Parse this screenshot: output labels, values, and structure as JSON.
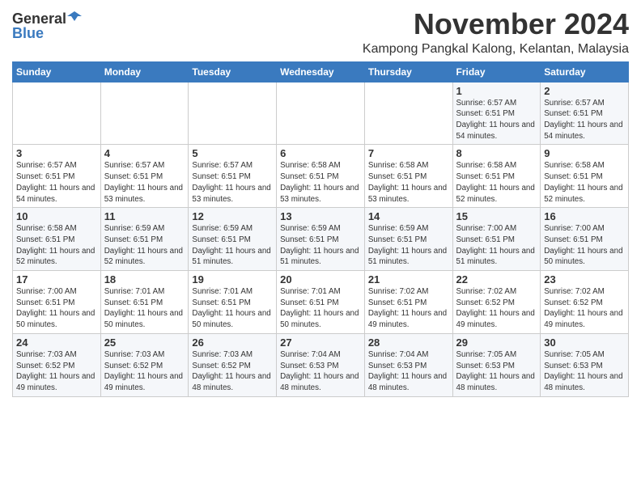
{
  "logo": {
    "general": "General",
    "blue": "Blue"
  },
  "header": {
    "month": "November 2024",
    "location": "Kampong Pangkal Kalong, Kelantan, Malaysia"
  },
  "weekdays": [
    "Sunday",
    "Monday",
    "Tuesday",
    "Wednesday",
    "Thursday",
    "Friday",
    "Saturday"
  ],
  "weeks": [
    [
      {
        "day": "",
        "sunrise": "",
        "sunset": "",
        "daylight": ""
      },
      {
        "day": "",
        "sunrise": "",
        "sunset": "",
        "daylight": ""
      },
      {
        "day": "",
        "sunrise": "",
        "sunset": "",
        "daylight": ""
      },
      {
        "day": "",
        "sunrise": "",
        "sunset": "",
        "daylight": ""
      },
      {
        "day": "",
        "sunrise": "",
        "sunset": "",
        "daylight": ""
      },
      {
        "day": "1",
        "sunrise": "Sunrise: 6:57 AM",
        "sunset": "Sunset: 6:51 PM",
        "daylight": "Daylight: 11 hours and 54 minutes."
      },
      {
        "day": "2",
        "sunrise": "Sunrise: 6:57 AM",
        "sunset": "Sunset: 6:51 PM",
        "daylight": "Daylight: 11 hours and 54 minutes."
      }
    ],
    [
      {
        "day": "3",
        "sunrise": "Sunrise: 6:57 AM",
        "sunset": "Sunset: 6:51 PM",
        "daylight": "Daylight: 11 hours and 54 minutes."
      },
      {
        "day": "4",
        "sunrise": "Sunrise: 6:57 AM",
        "sunset": "Sunset: 6:51 PM",
        "daylight": "Daylight: 11 hours and 53 minutes."
      },
      {
        "day": "5",
        "sunrise": "Sunrise: 6:57 AM",
        "sunset": "Sunset: 6:51 PM",
        "daylight": "Daylight: 11 hours and 53 minutes."
      },
      {
        "day": "6",
        "sunrise": "Sunrise: 6:58 AM",
        "sunset": "Sunset: 6:51 PM",
        "daylight": "Daylight: 11 hours and 53 minutes."
      },
      {
        "day": "7",
        "sunrise": "Sunrise: 6:58 AM",
        "sunset": "Sunset: 6:51 PM",
        "daylight": "Daylight: 11 hours and 53 minutes."
      },
      {
        "day": "8",
        "sunrise": "Sunrise: 6:58 AM",
        "sunset": "Sunset: 6:51 PM",
        "daylight": "Daylight: 11 hours and 52 minutes."
      },
      {
        "day": "9",
        "sunrise": "Sunrise: 6:58 AM",
        "sunset": "Sunset: 6:51 PM",
        "daylight": "Daylight: 11 hours and 52 minutes."
      }
    ],
    [
      {
        "day": "10",
        "sunrise": "Sunrise: 6:58 AM",
        "sunset": "Sunset: 6:51 PM",
        "daylight": "Daylight: 11 hours and 52 minutes."
      },
      {
        "day": "11",
        "sunrise": "Sunrise: 6:59 AM",
        "sunset": "Sunset: 6:51 PM",
        "daylight": "Daylight: 11 hours and 52 minutes."
      },
      {
        "day": "12",
        "sunrise": "Sunrise: 6:59 AM",
        "sunset": "Sunset: 6:51 PM",
        "daylight": "Daylight: 11 hours and 51 minutes."
      },
      {
        "day": "13",
        "sunrise": "Sunrise: 6:59 AM",
        "sunset": "Sunset: 6:51 PM",
        "daylight": "Daylight: 11 hours and 51 minutes."
      },
      {
        "day": "14",
        "sunrise": "Sunrise: 6:59 AM",
        "sunset": "Sunset: 6:51 PM",
        "daylight": "Daylight: 11 hours and 51 minutes."
      },
      {
        "day": "15",
        "sunrise": "Sunrise: 7:00 AM",
        "sunset": "Sunset: 6:51 PM",
        "daylight": "Daylight: 11 hours and 51 minutes."
      },
      {
        "day": "16",
        "sunrise": "Sunrise: 7:00 AM",
        "sunset": "Sunset: 6:51 PM",
        "daylight": "Daylight: 11 hours and 50 minutes."
      }
    ],
    [
      {
        "day": "17",
        "sunrise": "Sunrise: 7:00 AM",
        "sunset": "Sunset: 6:51 PM",
        "daylight": "Daylight: 11 hours and 50 minutes."
      },
      {
        "day": "18",
        "sunrise": "Sunrise: 7:01 AM",
        "sunset": "Sunset: 6:51 PM",
        "daylight": "Daylight: 11 hours and 50 minutes."
      },
      {
        "day": "19",
        "sunrise": "Sunrise: 7:01 AM",
        "sunset": "Sunset: 6:51 PM",
        "daylight": "Daylight: 11 hours and 50 minutes."
      },
      {
        "day": "20",
        "sunrise": "Sunrise: 7:01 AM",
        "sunset": "Sunset: 6:51 PM",
        "daylight": "Daylight: 11 hours and 50 minutes."
      },
      {
        "day": "21",
        "sunrise": "Sunrise: 7:02 AM",
        "sunset": "Sunset: 6:51 PM",
        "daylight": "Daylight: 11 hours and 49 minutes."
      },
      {
        "day": "22",
        "sunrise": "Sunrise: 7:02 AM",
        "sunset": "Sunset: 6:52 PM",
        "daylight": "Daylight: 11 hours and 49 minutes."
      },
      {
        "day": "23",
        "sunrise": "Sunrise: 7:02 AM",
        "sunset": "Sunset: 6:52 PM",
        "daylight": "Daylight: 11 hours and 49 minutes."
      }
    ],
    [
      {
        "day": "24",
        "sunrise": "Sunrise: 7:03 AM",
        "sunset": "Sunset: 6:52 PM",
        "daylight": "Daylight: 11 hours and 49 minutes."
      },
      {
        "day": "25",
        "sunrise": "Sunrise: 7:03 AM",
        "sunset": "Sunset: 6:52 PM",
        "daylight": "Daylight: 11 hours and 49 minutes."
      },
      {
        "day": "26",
        "sunrise": "Sunrise: 7:03 AM",
        "sunset": "Sunset: 6:52 PM",
        "daylight": "Daylight: 11 hours and 48 minutes."
      },
      {
        "day": "27",
        "sunrise": "Sunrise: 7:04 AM",
        "sunset": "Sunset: 6:53 PM",
        "daylight": "Daylight: 11 hours and 48 minutes."
      },
      {
        "day": "28",
        "sunrise": "Sunrise: 7:04 AM",
        "sunset": "Sunset: 6:53 PM",
        "daylight": "Daylight: 11 hours and 48 minutes."
      },
      {
        "day": "29",
        "sunrise": "Sunrise: 7:05 AM",
        "sunset": "Sunset: 6:53 PM",
        "daylight": "Daylight: 11 hours and 48 minutes."
      },
      {
        "day": "30",
        "sunrise": "Sunrise: 7:05 AM",
        "sunset": "Sunset: 6:53 PM",
        "daylight": "Daylight: 11 hours and 48 minutes."
      }
    ]
  ]
}
